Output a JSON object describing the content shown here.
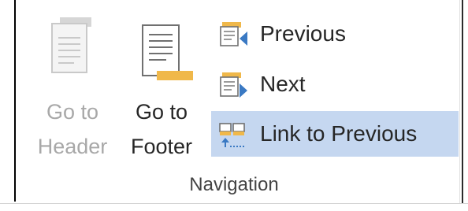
{
  "ribbon_group": {
    "name": "Navigation",
    "buttons": {
      "go_to_header": {
        "line1": "Go to",
        "line2": "Header",
        "enabled": false,
        "icon": "go-to-header-icon"
      },
      "go_to_footer": {
        "line1": "Go to",
        "line2": "Footer",
        "enabled": true,
        "icon": "go-to-footer-icon"
      },
      "previous": {
        "label": "Previous",
        "icon": "previous-section-icon"
      },
      "next": {
        "label": "Next",
        "icon": "next-section-icon"
      },
      "link_to_previous": {
        "label": "Link to Previous",
        "icon": "link-to-previous-icon",
        "active": true
      }
    }
  },
  "colors": {
    "accent_orange": "#f0b84a",
    "accent_blue": "#3a79c3",
    "highlight": "#c5d7f0",
    "disabled_text": "#a8a8a8"
  }
}
